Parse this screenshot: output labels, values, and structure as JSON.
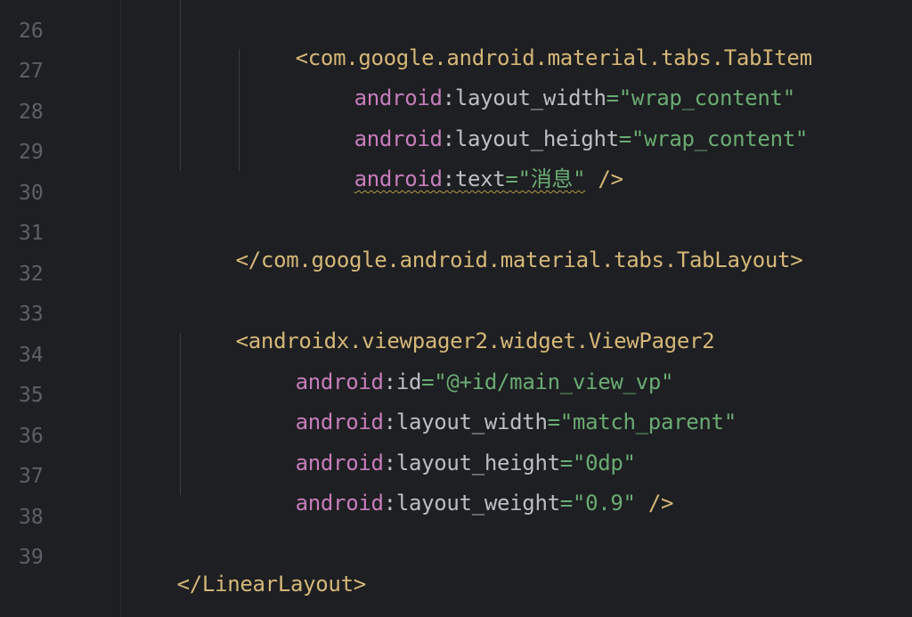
{
  "editor": {
    "line_numbers": [
      "26",
      "27",
      "28",
      "29",
      "30",
      "31",
      "32",
      "33",
      "34",
      "35",
      "36",
      "37",
      "38",
      "39"
    ],
    "lines": [
      {
        "open": "<",
        "tag": "com.google.android.material.tabs.TabItem"
      },
      {
        "ns": "android",
        "colon": ":",
        "attr": "layout_width",
        "eq": "=",
        "value": "\"wrap_content\""
      },
      {
        "ns": "android",
        "colon": ":",
        "attr": "layout_height",
        "eq": "=",
        "value": "\"wrap_content\""
      },
      {
        "ns": "android",
        "colon": ":",
        "attr": "text",
        "eq": "=",
        "value": "\"消息\"",
        "close": " />"
      },
      {},
      {
        "open": "</",
        "tag": "com.google.android.material.tabs.TabLayout",
        "close": ">"
      },
      {},
      {
        "open": "<",
        "tag": "androidx.viewpager2.widget.ViewPager2"
      },
      {
        "ns": "android",
        "colon": ":",
        "attr": "id",
        "eq": "=",
        "value": "\"@+id/main_view_vp\""
      },
      {
        "ns": "android",
        "colon": ":",
        "attr": "layout_width",
        "eq": "=",
        "value": "\"match_parent\""
      },
      {
        "ns": "android",
        "colon": ":",
        "attr": "layout_height",
        "eq": "=",
        "value": "\"0dp\""
      },
      {
        "ns": "android",
        "colon": ":",
        "attr": "layout_weight",
        "eq": "=",
        "value": "\"0.9\"",
        "close": " />"
      },
      {},
      {
        "open": "</",
        "tag": "LinearLayout",
        "close": ">"
      }
    ]
  }
}
